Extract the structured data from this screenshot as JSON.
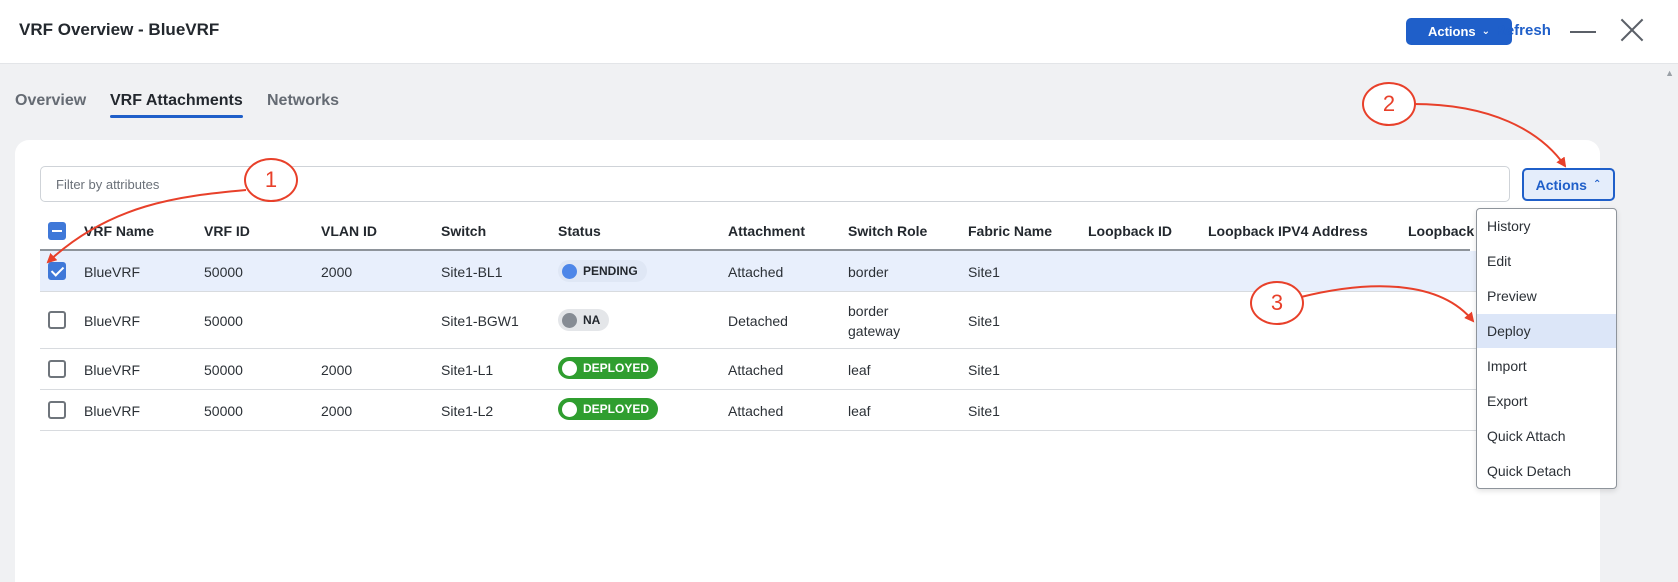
{
  "header": {
    "title": "VRF Overview - BlueVRF",
    "actions_label": "Actions",
    "refresh_label": "Refresh"
  },
  "tabs": [
    {
      "label": "Overview",
      "active": false
    },
    {
      "label": "VRF Attachments",
      "active": true
    },
    {
      "label": "Networks",
      "active": false
    }
  ],
  "toolbar": {
    "filter_placeholder": "Filter by attributes",
    "actions_label": "Actions"
  },
  "table": {
    "columns": [
      "VRF Name",
      "VRF ID",
      "VLAN ID",
      "Switch",
      "Status",
      "Attachment",
      "Switch Role",
      "Fabric Name",
      "Loopback ID",
      "Loopback IPV4 Address",
      "Loopback"
    ],
    "rows": [
      {
        "selected": true,
        "vrf_name": "BlueVRF",
        "vrf_id": "50000",
        "vlan_id": "2000",
        "switch": "Site1-BL1",
        "status": "PENDING",
        "attachment": "Attached",
        "switch_role": "border",
        "switch_role_2": "",
        "fabric": "Site1"
      },
      {
        "selected": false,
        "vrf_name": "BlueVRF",
        "vrf_id": "50000",
        "vlan_id": "",
        "switch": "Site1-BGW1",
        "status": "NA",
        "attachment": "Detached",
        "switch_role": "border",
        "switch_role_2": "gateway",
        "fabric": "Site1"
      },
      {
        "selected": false,
        "vrf_name": "BlueVRF",
        "vrf_id": "50000",
        "vlan_id": "2000",
        "switch": "Site1-L1",
        "status": "DEPLOYED",
        "attachment": "Attached",
        "switch_role": "leaf",
        "switch_role_2": "",
        "fabric": "Site1"
      },
      {
        "selected": false,
        "vrf_name": "BlueVRF",
        "vrf_id": "50000",
        "vlan_id": "2000",
        "switch": "Site1-L2",
        "status": "DEPLOYED",
        "attachment": "Attached",
        "switch_role": "leaf",
        "switch_role_2": "",
        "fabric": "Site1"
      }
    ]
  },
  "actions_menu": {
    "items": [
      "History",
      "Edit",
      "Preview",
      "Deploy",
      "Import",
      "Export",
      "Quick Attach",
      "Quick Detach"
    ],
    "highlighted": "Deploy"
  },
  "annotations": {
    "step1": "1",
    "step2": "2",
    "step3": "3",
    "color": "#e8402a"
  },
  "colors": {
    "accent": "#1f5fc9",
    "deployed": "#2f9e2f",
    "pending_dot": "#4d86e8"
  }
}
